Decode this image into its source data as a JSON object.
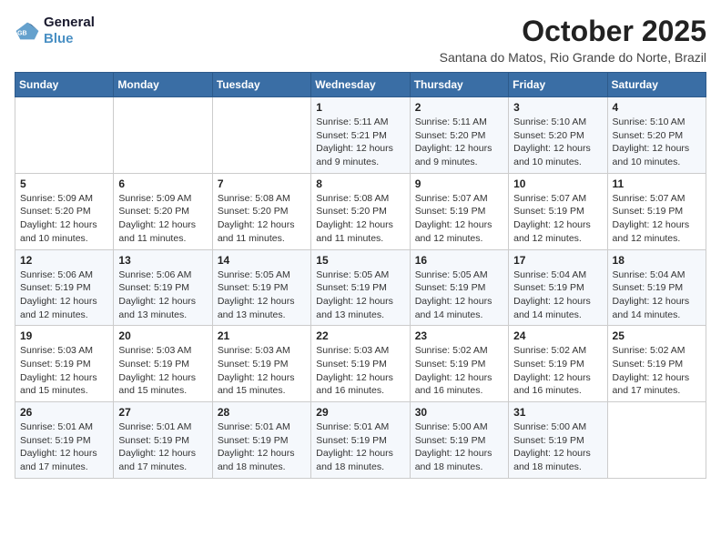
{
  "logo": {
    "line1": "General",
    "line2": "Blue"
  },
  "title": "October 2025",
  "location": "Santana do Matos, Rio Grande do Norte, Brazil",
  "weekdays": [
    "Sunday",
    "Monday",
    "Tuesday",
    "Wednesday",
    "Thursday",
    "Friday",
    "Saturday"
  ],
  "weeks": [
    [
      {
        "day": "",
        "info": ""
      },
      {
        "day": "",
        "info": ""
      },
      {
        "day": "",
        "info": ""
      },
      {
        "day": "1",
        "info": "Sunrise: 5:11 AM\nSunset: 5:21 PM\nDaylight: 12 hours\nand 9 minutes."
      },
      {
        "day": "2",
        "info": "Sunrise: 5:11 AM\nSunset: 5:20 PM\nDaylight: 12 hours\nand 9 minutes."
      },
      {
        "day": "3",
        "info": "Sunrise: 5:10 AM\nSunset: 5:20 PM\nDaylight: 12 hours\nand 10 minutes."
      },
      {
        "day": "4",
        "info": "Sunrise: 5:10 AM\nSunset: 5:20 PM\nDaylight: 12 hours\nand 10 minutes."
      }
    ],
    [
      {
        "day": "5",
        "info": "Sunrise: 5:09 AM\nSunset: 5:20 PM\nDaylight: 12 hours\nand 10 minutes."
      },
      {
        "day": "6",
        "info": "Sunrise: 5:09 AM\nSunset: 5:20 PM\nDaylight: 12 hours\nand 11 minutes."
      },
      {
        "day": "7",
        "info": "Sunrise: 5:08 AM\nSunset: 5:20 PM\nDaylight: 12 hours\nand 11 minutes."
      },
      {
        "day": "8",
        "info": "Sunrise: 5:08 AM\nSunset: 5:20 PM\nDaylight: 12 hours\nand 11 minutes."
      },
      {
        "day": "9",
        "info": "Sunrise: 5:07 AM\nSunset: 5:19 PM\nDaylight: 12 hours\nand 12 minutes."
      },
      {
        "day": "10",
        "info": "Sunrise: 5:07 AM\nSunset: 5:19 PM\nDaylight: 12 hours\nand 12 minutes."
      },
      {
        "day": "11",
        "info": "Sunrise: 5:07 AM\nSunset: 5:19 PM\nDaylight: 12 hours\nand 12 minutes."
      }
    ],
    [
      {
        "day": "12",
        "info": "Sunrise: 5:06 AM\nSunset: 5:19 PM\nDaylight: 12 hours\nand 12 minutes."
      },
      {
        "day": "13",
        "info": "Sunrise: 5:06 AM\nSunset: 5:19 PM\nDaylight: 12 hours\nand 13 minutes."
      },
      {
        "day": "14",
        "info": "Sunrise: 5:05 AM\nSunset: 5:19 PM\nDaylight: 12 hours\nand 13 minutes."
      },
      {
        "day": "15",
        "info": "Sunrise: 5:05 AM\nSunset: 5:19 PM\nDaylight: 12 hours\nand 13 minutes."
      },
      {
        "day": "16",
        "info": "Sunrise: 5:05 AM\nSunset: 5:19 PM\nDaylight: 12 hours\nand 14 minutes."
      },
      {
        "day": "17",
        "info": "Sunrise: 5:04 AM\nSunset: 5:19 PM\nDaylight: 12 hours\nand 14 minutes."
      },
      {
        "day": "18",
        "info": "Sunrise: 5:04 AM\nSunset: 5:19 PM\nDaylight: 12 hours\nand 14 minutes."
      }
    ],
    [
      {
        "day": "19",
        "info": "Sunrise: 5:03 AM\nSunset: 5:19 PM\nDaylight: 12 hours\nand 15 minutes."
      },
      {
        "day": "20",
        "info": "Sunrise: 5:03 AM\nSunset: 5:19 PM\nDaylight: 12 hours\nand 15 minutes."
      },
      {
        "day": "21",
        "info": "Sunrise: 5:03 AM\nSunset: 5:19 PM\nDaylight: 12 hours\nand 15 minutes."
      },
      {
        "day": "22",
        "info": "Sunrise: 5:03 AM\nSunset: 5:19 PM\nDaylight: 12 hours\nand 16 minutes."
      },
      {
        "day": "23",
        "info": "Sunrise: 5:02 AM\nSunset: 5:19 PM\nDaylight: 12 hours\nand 16 minutes."
      },
      {
        "day": "24",
        "info": "Sunrise: 5:02 AM\nSunset: 5:19 PM\nDaylight: 12 hours\nand 16 minutes."
      },
      {
        "day": "25",
        "info": "Sunrise: 5:02 AM\nSunset: 5:19 PM\nDaylight: 12 hours\nand 17 minutes."
      }
    ],
    [
      {
        "day": "26",
        "info": "Sunrise: 5:01 AM\nSunset: 5:19 PM\nDaylight: 12 hours\nand 17 minutes."
      },
      {
        "day": "27",
        "info": "Sunrise: 5:01 AM\nSunset: 5:19 PM\nDaylight: 12 hours\nand 17 minutes."
      },
      {
        "day": "28",
        "info": "Sunrise: 5:01 AM\nSunset: 5:19 PM\nDaylight: 12 hours\nand 18 minutes."
      },
      {
        "day": "29",
        "info": "Sunrise: 5:01 AM\nSunset: 5:19 PM\nDaylight: 12 hours\nand 18 minutes."
      },
      {
        "day": "30",
        "info": "Sunrise: 5:00 AM\nSunset: 5:19 PM\nDaylight: 12 hours\nand 18 minutes."
      },
      {
        "day": "31",
        "info": "Sunrise: 5:00 AM\nSunset: 5:19 PM\nDaylight: 12 hours\nand 18 minutes."
      },
      {
        "day": "",
        "info": ""
      }
    ]
  ]
}
